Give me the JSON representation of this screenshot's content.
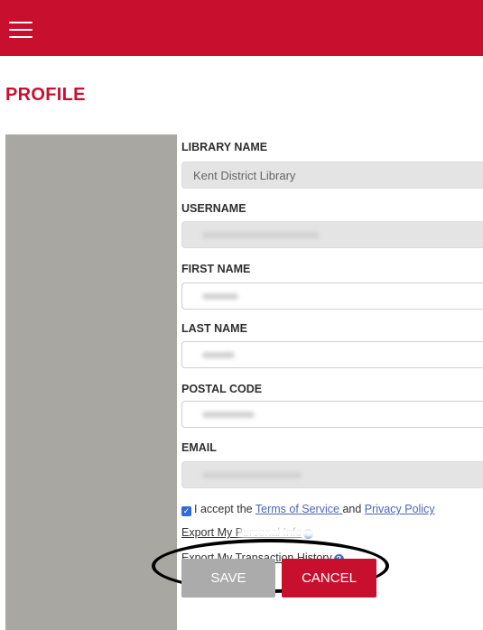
{
  "colors": {
    "brand": "#c8102e",
    "sidebar": "#a8a7a1",
    "link": "#4a66b8",
    "save_button": "#ababab"
  },
  "header": {
    "menu_icon": "hamburger-menu-icon"
  },
  "page": {
    "title": "PROFILE"
  },
  "form": {
    "library_name": {
      "label": "LIBRARY NAME",
      "value": "Kent District Library"
    },
    "username": {
      "label": "USERNAME",
      "value": ""
    },
    "first_name": {
      "label": "FIRST NAME",
      "value": ""
    },
    "last_name": {
      "label": "LAST NAME",
      "value": ""
    },
    "postal_code": {
      "label": "POSTAL CODE",
      "value": ""
    },
    "email": {
      "label": "EMAIL",
      "value": ""
    },
    "terms": {
      "checked": true,
      "prefix": "I accept the ",
      "terms_link": "Terms of Service ",
      "conjunction": "and ",
      "privacy_link": "Privacy Policy"
    },
    "export_personal": {
      "label": "Export My Personal Info",
      "help_icon": "question-circle-icon"
    },
    "export_transactions": {
      "label": "Export My Transaction History",
      "help_icon": "question-circle-icon"
    },
    "save_label": "SAVE",
    "cancel_label": "CANCEL"
  }
}
